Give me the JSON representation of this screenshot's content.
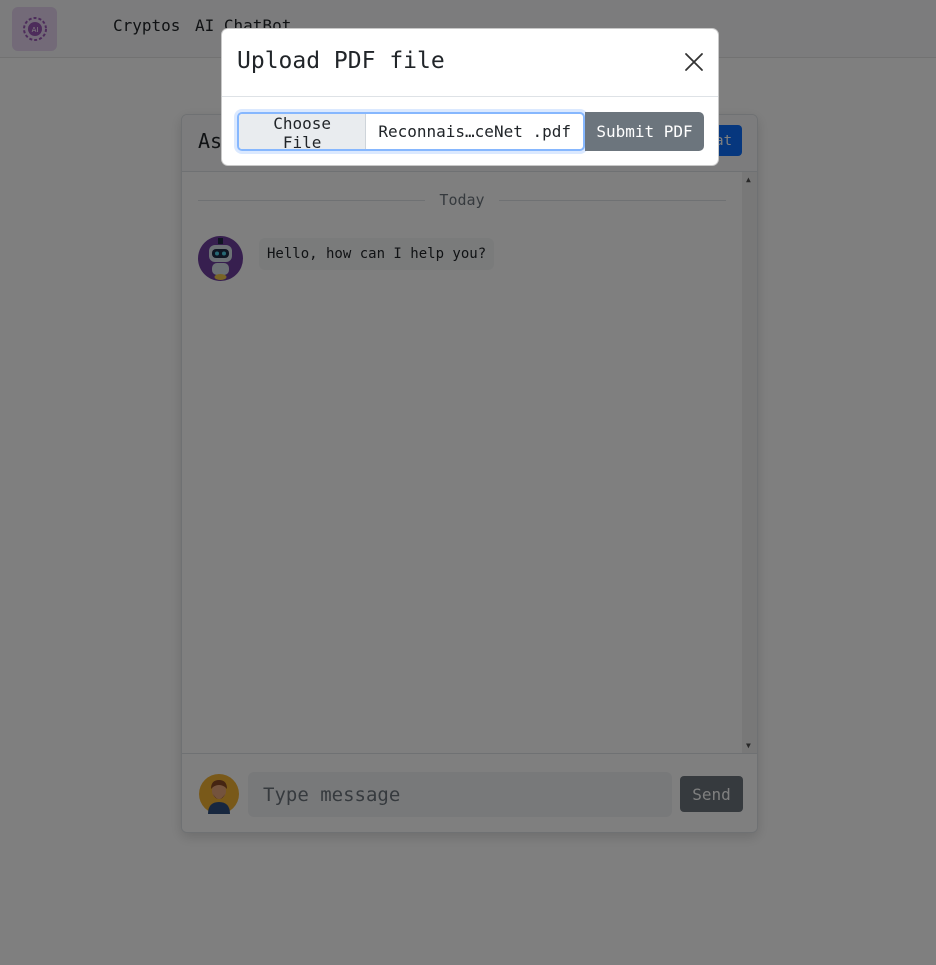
{
  "navbar": {
    "logo_text": "AI",
    "links": [
      "Cryptos",
      "AI ChatBot"
    ]
  },
  "chat": {
    "title": "Assistant",
    "new_chat_label": "New Chat",
    "divider_label": "Today",
    "messages": [
      {
        "sender": "bot",
        "text": "Hello, how can I help you?"
      }
    ],
    "input_placeholder": "Type message",
    "send_label": "Send"
  },
  "modal": {
    "title": "Upload PDF file",
    "choose_file_label": "Choose File",
    "file_name": "Reconnais…ceNet .pdf",
    "submit_label": "Submit PDF"
  },
  "colors": {
    "primary": "#0d6efd",
    "secondary": "#6c757d",
    "logo_bg": "#e6d4f0",
    "focus_ring": "#86b7fe"
  }
}
